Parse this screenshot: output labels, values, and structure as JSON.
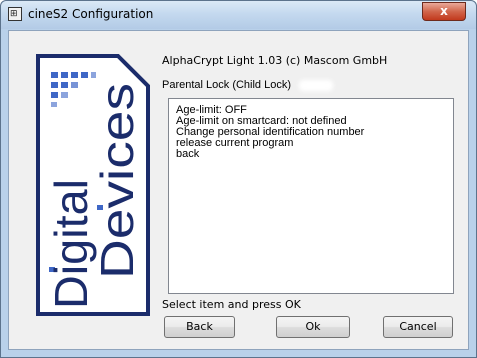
{
  "window": {
    "title": "cineS2 Configuration",
    "close_label": "x"
  },
  "logo": {
    "text": "Digital Devices",
    "line1": "Digital",
    "line2": "Devices",
    "color": "#1b2c6b",
    "accent": "#3f67c6"
  },
  "content": {
    "version": "AlphaCrypt Light 1.03 (c) Mascom GmbH",
    "menu_title": "Parental Lock (Child Lock)",
    "items": [
      "Age-limit: OFF",
      "Age-limit on smartcard: not defined",
      "Change personal identification number",
      "release current program",
      "back"
    ],
    "hint": "Select item and press OK"
  },
  "buttons": {
    "back": "Back",
    "ok": "Ok",
    "cancel": "Cancel"
  }
}
